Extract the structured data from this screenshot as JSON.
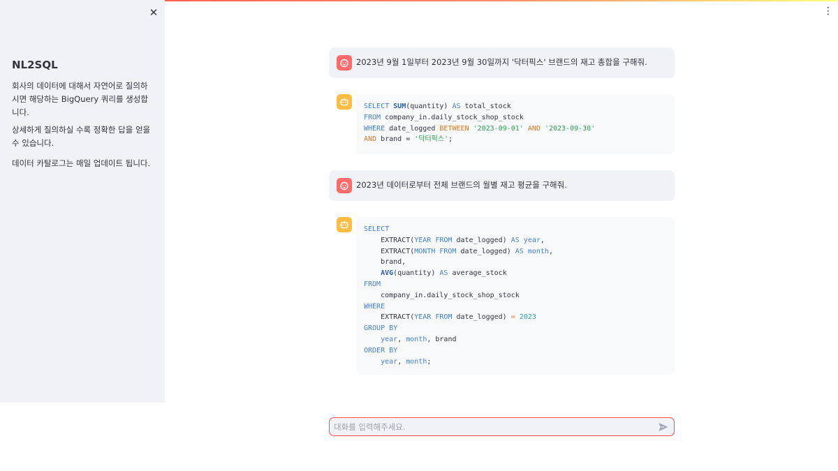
{
  "sidebar": {
    "close_label": "✕",
    "title": "NL2SQL",
    "paragraphs": [
      "회사의 데이터에 대해서 자연어로 질의하시면 해당하는 BigQuery 쿼리를 생성합니다.",
      "상세하게 질의하실 수록 정확한 답을 얻을 수 있습니다.",
      "데이터 카탈로그는 매일 업데이트 됩니다."
    ]
  },
  "main_menu": {
    "label": "⋮"
  },
  "messages": [
    {
      "role": "user",
      "text": "2023년 9월 1일부터 2023년 9월 30일까지 '닥터픽스' 브랜드의 재고 총합을 구해줘.",
      "avatar_icon": "user-face-icon"
    },
    {
      "role": "assistant",
      "avatar_icon": "bot-icon",
      "code_lines": [
        "SELECT SUM(quantity) AS total_stock",
        "FROM company_in.daily_stock_shop_stock",
        "WHERE date_logged BETWEEN '2023-09-01' AND '2023-09-30'",
        "AND brand = '닥터픽스';"
      ]
    },
    {
      "role": "user",
      "text": "2023년 데이터로부터 전체 브랜드의 월별 재고 평균을 구해줘.",
      "avatar_icon": "user-face-icon"
    },
    {
      "role": "assistant",
      "avatar_icon": "bot-icon",
      "code_lines": [
        "SELECT",
        "    EXTRACT(YEAR FROM date_logged) AS year,",
        "    EXTRACT(MONTH FROM date_logged) AS month,",
        "    brand,",
        "    AVG(quantity) AS average_stock",
        "FROM",
        "    company_in.daily_stock_shop_stock",
        "WHERE",
        "    EXTRACT(YEAR FROM date_logged) = 2023",
        "GROUP BY",
        "    year, month, brand",
        "ORDER BY",
        "    year, month;"
      ]
    }
  ],
  "chat_input": {
    "placeholder": "대화를 입력해주세요.",
    "value": ""
  },
  "colors": {
    "accent": "#ff4b4b",
    "sidebar_bg": "#f0f2f6",
    "user_avatar": "#ff6b6b",
    "bot_avatar": "#ffbd45"
  }
}
